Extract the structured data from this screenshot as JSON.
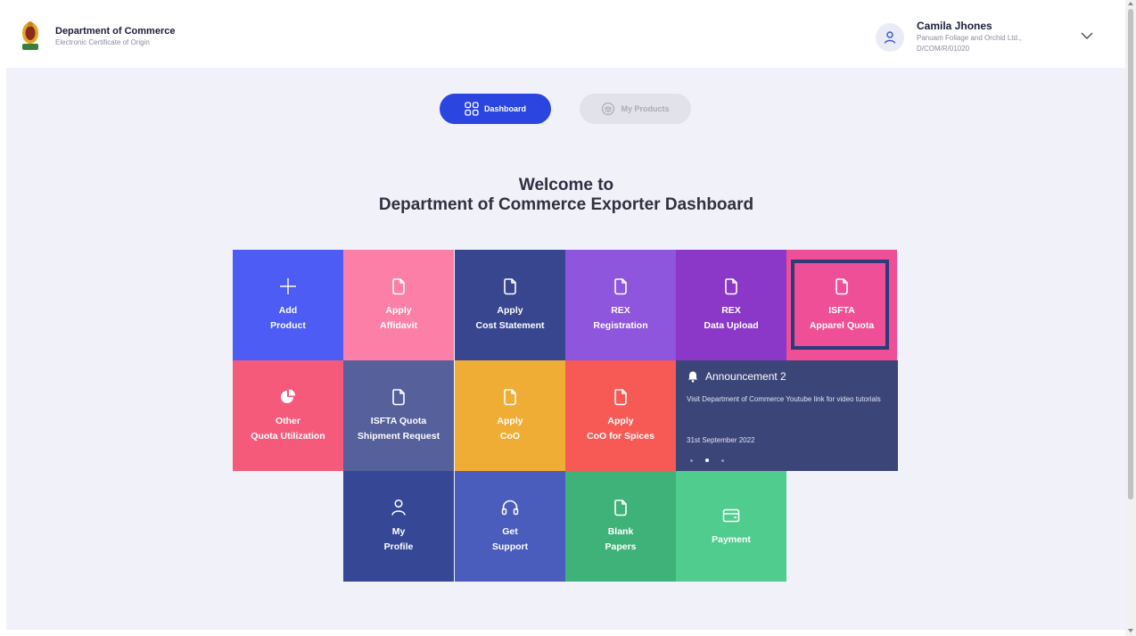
{
  "header": {
    "org_name": "Department of Commerce",
    "org_sub": "Electronic Certificate of Origin",
    "user_name": "Camila Jhones",
    "user_org": "Panuam Foliage and Orchid Ltd.,",
    "user_id": "D/COM/R/01020",
    "avatar_icon": "user-icon",
    "menu_icon": "chevron-down-icon"
  },
  "tabs": [
    {
      "label": "Dashboard",
      "icon": "grid-icon",
      "active": true
    },
    {
      "label": "My Products",
      "icon": "box-icon",
      "active": false
    }
  ],
  "welcome": {
    "line1": "Welcome to",
    "line2": "Department of Commerce Exporter Dashboard"
  },
  "tiles": [
    {
      "line1": "Add",
      "line2": "Product",
      "icon": "plus-icon",
      "color": "#4c5cf5"
    },
    {
      "line1": "Apply",
      "line2": "Affidavit",
      "icon": "document-icon",
      "color": "#fb7fa6"
    },
    {
      "line1": "Apply",
      "line2": "Cost Statement",
      "icon": "document-icon",
      "color": "#38468f"
    },
    {
      "line1": "REX",
      "line2": "Registration",
      "icon": "document-icon",
      "color": "#8e55dd"
    },
    {
      "line1": "REX",
      "line2": "Data Upload",
      "icon": "document-icon",
      "color": "#8b38c8"
    },
    {
      "line1": "ISFTA",
      "line2": "Apparel Quota",
      "icon": "document-icon",
      "color": "#ef4f96"
    },
    {
      "line1": "Other",
      "line2": "Quota Utilization",
      "icon": "pie-chart-icon",
      "color": "#f55a7b"
    },
    {
      "line1": "ISFTA Quota",
      "line2": "Shipment Request",
      "icon": "document-icon",
      "color": "#56609b"
    },
    {
      "line1": "Apply",
      "line2": "CoO",
      "icon": "document-icon",
      "color": "#f0ad35"
    },
    {
      "line1": "Apply",
      "line2": "CoO for Spices",
      "icon": "document-icon",
      "color": "#f75a55"
    },
    {
      "line1": "My",
      "line2": "Profile",
      "icon": "user-icon",
      "color": "#364796"
    },
    {
      "line1": "Get",
      "line2": "Support",
      "icon": "headset-icon",
      "color": "#4a5cbc"
    },
    {
      "line1": "Blank",
      "line2": "Papers",
      "icon": "document-icon",
      "color": "#3fb279"
    },
    {
      "line1": "",
      "line2": "Payment",
      "icon": "wallet-icon",
      "color": "#50cc8e"
    }
  ],
  "announcement": {
    "title": "Announcement 2",
    "body": "Visit Department of Commerce Youtube link for video tutorials",
    "date": "31st September 2022",
    "icon": "bell-icon",
    "color": "#3b4577"
  }
}
